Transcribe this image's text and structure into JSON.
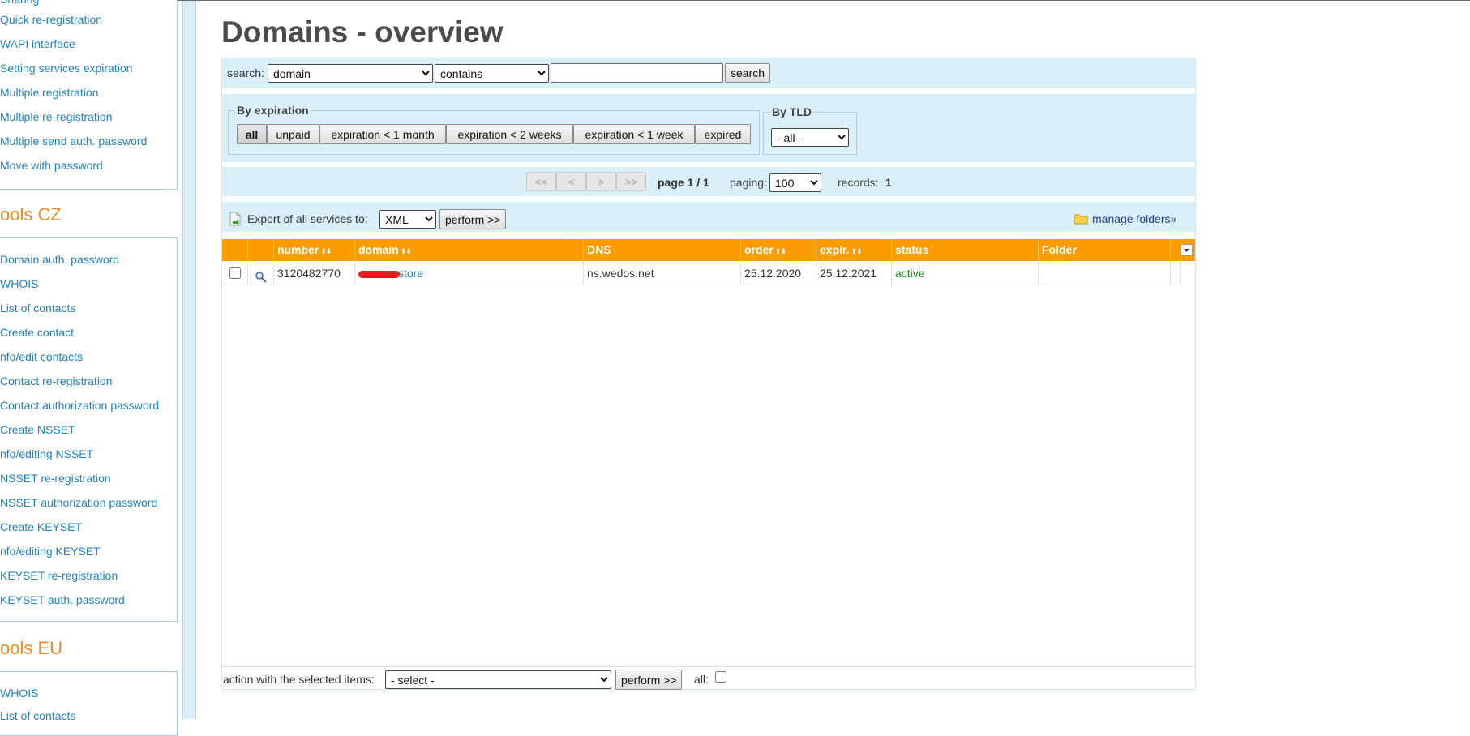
{
  "sidebar": {
    "group1_links": [
      "Quick re-registration",
      "WAPI interface",
      "Setting services expiration",
      "Multiple registration",
      "Multiple re-registration",
      "Multiple send auth. password",
      "Move with password"
    ],
    "tools_cz_title": "ools CZ",
    "tools_cz_links": [
      "Domain auth. password",
      "WHOIS",
      "List of contacts",
      "Create contact",
      "nfo/edit contacts",
      "Contact re-registration",
      "Contact authorization password",
      "Create NSSET",
      "nfo/editing NSSET",
      "NSSET re-registration",
      "NSSET authorization password",
      "Create KEYSET",
      "nfo/editing KEYSET",
      "KEYSET re-registration",
      "KEYSET auth. password"
    ],
    "tools_eu_title": "ools EU",
    "tools_eu_links": [
      "WHOIS",
      "List of contacts"
    ]
  },
  "page": {
    "title": "Domains - overview"
  },
  "search": {
    "label": "search:",
    "field_selected": "domain",
    "operator_selected": "contains",
    "value": "",
    "button": "search"
  },
  "filters": {
    "expiration_legend": "By expiration",
    "expiration_buttons": [
      "all",
      "unpaid",
      "expiration < 1 month",
      "expiration < 2 weeks",
      "expiration < 1 week",
      "expired"
    ],
    "active_filter": "all",
    "tld_legend": "By TLD",
    "tld_selected": "- all -"
  },
  "pager": {
    "first": "<<",
    "prev": "<",
    "next": ">",
    "last": ">>",
    "page_text": "page 1 / 1",
    "paging_label": "paging:",
    "paging_value": "100",
    "records_label": "records:",
    "records_value": "1"
  },
  "export": {
    "label": "Export of all services to:",
    "format_selected": "XML",
    "perform": "perform >>",
    "manage_folders": "manage folders»"
  },
  "table": {
    "columns": [
      "number",
      "domain",
      "DNS",
      "order",
      "expir.",
      "status",
      "Folder"
    ],
    "rows": [
      {
        "number": "3120482770",
        "domain_suffix": "store",
        "dns": "ns.wedos.net",
        "order": "25.12.2020",
        "expir": "25.12.2021",
        "status": "active",
        "folder": ""
      }
    ]
  },
  "bulk_action": {
    "label": "action with the selected items:",
    "selected": "- select -",
    "perform": "perform >>",
    "all_label": "all:"
  },
  "colors": {
    "header_orange": "#fb9c02",
    "band_blue": "#d9f0f9",
    "link_blue": "#1e82c4",
    "sidebar_title_orange": "#f08a1c",
    "status_green": "#1a8a1a"
  }
}
